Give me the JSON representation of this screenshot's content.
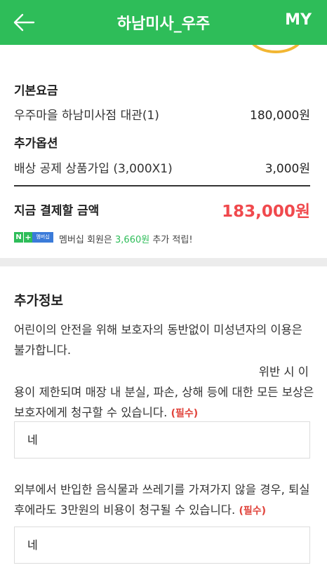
{
  "header": {
    "title": "하남미사_우주",
    "my_label": "MY"
  },
  "pricing": {
    "base_fee_label": "기본요금",
    "base_item": "우주마을 하남미사점 대관(1)",
    "base_price": "180,000원",
    "options_label": "추가옵션",
    "option_item": "배상 공제 상품가입 (3,000X1)",
    "option_price": "3,000원",
    "total_label": "지금 결제할 금액",
    "total_value": "183,000원"
  },
  "membership": {
    "badge_n": "N",
    "badge_plus": "+",
    "badge_text": "멤버십",
    "note_prefix": "멤버십 회원은 ",
    "note_points": "3,660원",
    "note_suffix": " 추가 적립!"
  },
  "extra_info": {
    "title": "추가정보",
    "q1_line1": "어린이의 안전을 위해 보호자의 동반없이 미성년자의 이용은 불가합니다.",
    "q1_line2": "위반 시 이",
    "q1_line3": "용이 제한되며 매장 내 분실, 파손, 상해 등에 대한 모든 보상은 보호자에게 청구할 수 있습니다.",
    "q1_required": "(필수)",
    "q1_answer": "네",
    "q2_text": "외부에서 반입한 음식물과 쓰레기를 가져가지 않을 경우, 퇴실후에라도 3만원의 비용이 청구될 수 있습니다.",
    "q2_required": "(필수)",
    "q2_answer": "네"
  },
  "colors": {
    "brand_green": "#2ebd59",
    "total_red": "#f0494d",
    "required_red": "#e0433b",
    "membership_blue": "#3b7bd9"
  },
  "icons": {
    "back": "arrow-left-icon"
  }
}
